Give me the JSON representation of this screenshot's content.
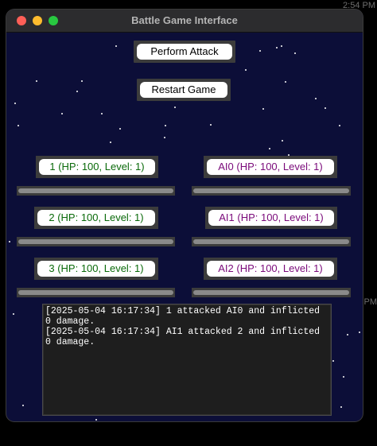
{
  "system": {
    "clock": "2:54 PM",
    "edge_text": "PM"
  },
  "window": {
    "title": "Battle Game Interface"
  },
  "controls": {
    "attack_label": "Perform Attack",
    "restart_label": "Restart Game"
  },
  "players": [
    {
      "label": "1 (HP: 100, Level: 1)",
      "hp_fraction": 1.0
    },
    {
      "label": "2 (HP: 100, Level: 1)",
      "hp_fraction": 1.0
    },
    {
      "label": "3 (HP: 100, Level: 1)",
      "hp_fraction": 1.0
    }
  ],
  "ais": [
    {
      "label": "AI0 (HP: 100, Level: 1)",
      "hp_fraction": 1.0
    },
    {
      "label": "AI1 (HP: 100, Level: 1)",
      "hp_fraction": 1.0
    },
    {
      "label": "AI2 (HP: 100, Level: 1)",
      "hp_fraction": 1.0
    }
  ],
  "battle_log": [
    "[2025-05-04 16:17:34] 1 attacked AI0 and inflicted 0 damage.",
    "[2025-05-04 16:17:34] AI1 attacked 2 and inflicted 0 damage."
  ],
  "colors": {
    "background": "#0c0e38",
    "player_text": "#0a6a0a",
    "ai_text": "#7a0a7a"
  }
}
